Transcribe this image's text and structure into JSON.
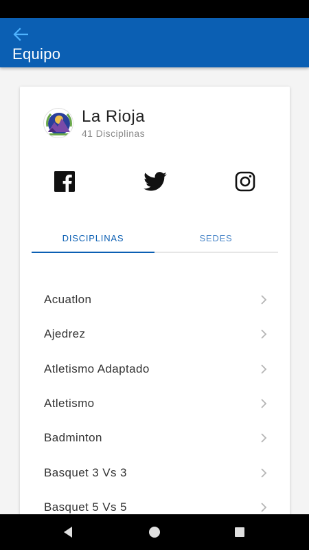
{
  "app_bar": {
    "title": "Equipo",
    "back_icon": "arrow-back-icon"
  },
  "team": {
    "name": "La Rioja",
    "subtitle": "41 Disciplinas",
    "avatar_icon": "team-crest-icon"
  },
  "social": [
    {
      "name": "facebook",
      "icon": "facebook-icon"
    },
    {
      "name": "twitter",
      "icon": "twitter-icon"
    },
    {
      "name": "instagram",
      "icon": "instagram-icon"
    }
  ],
  "tabs": [
    {
      "label": "DISCIPLINAS",
      "active": true
    },
    {
      "label": "SEDES",
      "active": false
    }
  ],
  "disciplines": [
    {
      "label": "Acuatlon"
    },
    {
      "label": "Ajedrez"
    },
    {
      "label": "Atletismo Adaptado"
    },
    {
      "label": "Atletismo"
    },
    {
      "label": "Badminton"
    },
    {
      "label": "Basquet 3 Vs 3"
    },
    {
      "label": "Basquet 5 Vs 5"
    }
  ],
  "colors": {
    "primary": "#0b5fb3",
    "tab_inactive": "#4a86c8",
    "text": "#333333",
    "subtext": "#8a8a8a",
    "chevron": "#b5b5b5"
  }
}
